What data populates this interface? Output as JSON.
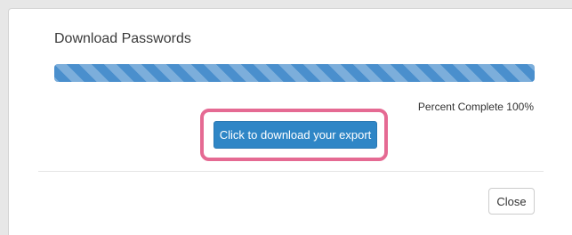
{
  "modal": {
    "title": "Download Passwords",
    "progress": {
      "percent": 100,
      "label": "Percent Complete 100%",
      "bar_color": "#4a8fcd"
    },
    "download_button_label": "Click to download your export",
    "download_button_color": "#2f86c6",
    "highlight_color": "#e56a93",
    "close_button_label": "Close"
  }
}
